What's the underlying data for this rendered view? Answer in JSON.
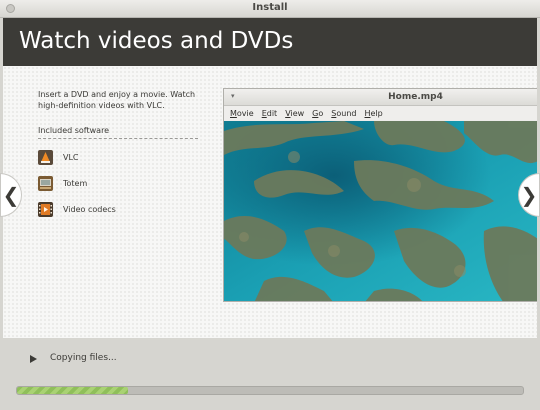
{
  "window": {
    "title": "Install"
  },
  "banner": {
    "heading": "Watch videos and DVDs"
  },
  "slide": {
    "intro": "Insert a DVD and enjoy a movie. Watch high-definition videos with VLC.",
    "software_heading": "Included software",
    "software": [
      {
        "label": "VLC",
        "icon": "vlc-icon",
        "color": "#c8581e"
      },
      {
        "label": "Totem",
        "icon": "totem-icon",
        "color": "#8b6a3a"
      },
      {
        "label": "Video codecs",
        "icon": "film-icon",
        "color": "#d06a20"
      }
    ],
    "prev_arrow": "❮",
    "next_arrow": "❯"
  },
  "player": {
    "title": "Home.mp4",
    "menu": [
      "Movie",
      "Edit",
      "View",
      "Go",
      "Sound",
      "Help"
    ],
    "menu_mnemonics": [
      "M",
      "E",
      "V",
      "G",
      "S",
      "H"
    ]
  },
  "status": {
    "text": "Copying files...",
    "progress": 0.22,
    "progress_color": "#8fbf5a"
  },
  "colors": {
    "banner": "#3c3b37",
    "background": "#f7f7f6",
    "accent": "#3c3b37"
  }
}
